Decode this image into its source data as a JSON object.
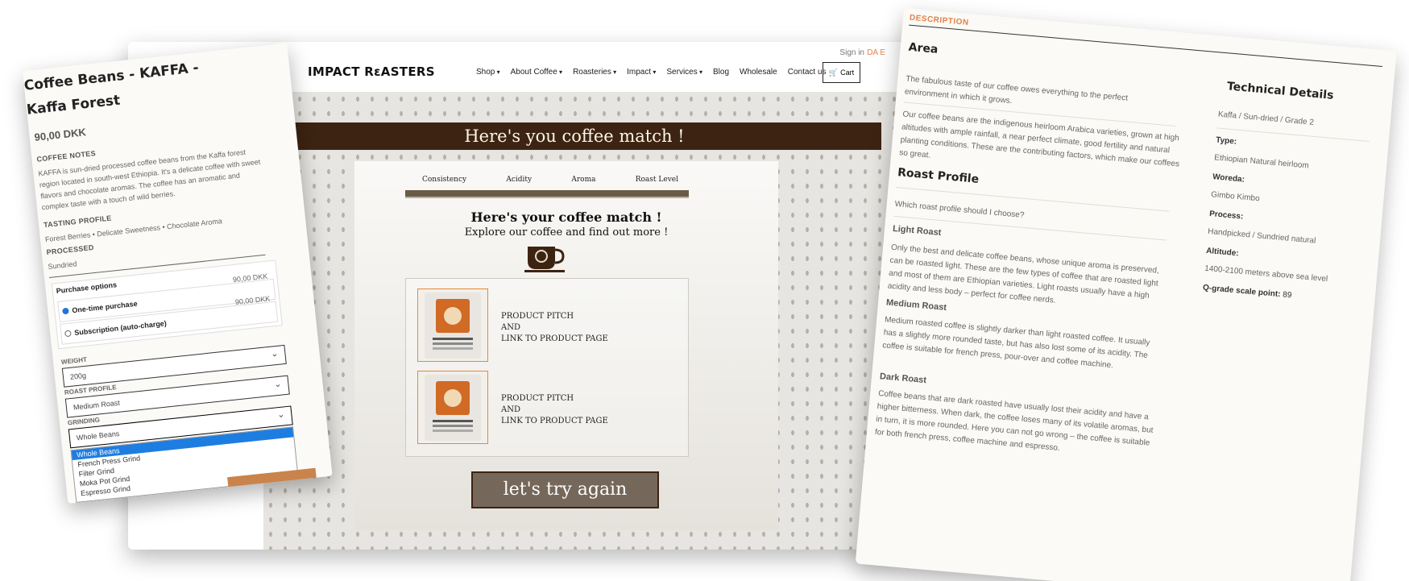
{
  "page": {
    "signin": "Sign in",
    "lang": "DA E",
    "logo": "IMPACT RɛASTERS",
    "nav": [
      "Shop",
      "About Coffee",
      "Roasteries",
      "Impact",
      "Services",
      "Blog",
      "Wholesale",
      "Contact us"
    ],
    "cart": "Cart",
    "banner": "Here's you coffee match !",
    "tabs": [
      "Consistency",
      "Acidity",
      "Aroma",
      "Roast Level"
    ],
    "match_title": "Here's your coffee match !",
    "match_subtitle": "Explore our coffee and find out more !",
    "products": [
      {
        "line1": "PRODUCT PITCH",
        "line2": "AND",
        "line3": "LINK TO PRODUCT PAGE"
      },
      {
        "line1": "PRODUCT PITCH",
        "line2": "AND",
        "line3": "LINK TO PRODUCT PAGE"
      }
    ],
    "try_again": "let's try again"
  },
  "product": {
    "title": "Coffee Beans - KAFFA - Kaffa Forest",
    "price": "90,00 DKK",
    "notes_h": "COFFEE NOTES",
    "notes": "KAFFA is sun-dried processed coffee beans from the Kaffa forest region located in south-west Ethiopia. It's a delicate coffee with sweet flavors and chocolate aromas. The coffee has an aromatic and complex taste with a touch of wild berries.",
    "tasting_h": "TASTING PROFILE",
    "tasting": "Forest Berries • Delicate Sweetness • Chocolate Aroma",
    "processed_h": "PROCESSED",
    "processed": "Sundried",
    "purchase_h": "Purchase options",
    "one_time": "One-time purchase",
    "one_time_price": "90,00 DKK",
    "subscription": "Subscription (auto-charge)",
    "subscription_price": "90,00 DKK",
    "weight_label": "WEIGHT",
    "weight": "200g",
    "roast_label": "ROAST PROFILE",
    "roast": "Medium Roast",
    "grinding_label": "GRINDING",
    "grinding": "Whole Beans",
    "grind_options": [
      "Whole Beans",
      "French Press Grind",
      "Filter Grind",
      "Moka Pot Grind",
      "Espresso Grind"
    ]
  },
  "description": {
    "heading": "DESCRIPTION",
    "area_h": "Area",
    "area_p1": "The fabulous taste of our coffee owes everything to the perfect environment in which it grows.",
    "area_p2": "Our coffee beans are the indigenous heirloom Arabica varieties, grown at high altitudes with ample rainfall, a near perfect climate, good fertility and natural planting conditions. These are the contributing factors, which make our coffees so great.",
    "roast_h": "Roast Profile",
    "roast_q": "Which roast profile should I choose?",
    "light_h": "Light Roast",
    "light_p": "Only the best and delicate coffee beans, whose unique aroma is preserved, can be roasted light. These are the few types of coffee that are roasted light and most of them are Ethiopian varieties. Light roasts usually have a high acidity and less body – perfect for coffee nerds.",
    "medium_h": "Medium Roast",
    "medium_p": "Medium roasted coffee is slightly darker than light roasted coffee. It usually has a slightly more rounded taste, but has also lost some of its acidity. The coffee is suitable for french press, pour-over and coffee machine.",
    "dark_h": "Dark Roast",
    "dark_p": "Coffee beans that are dark roasted have usually lost their acidity and have a higher bitterness. When dark, the coffee loses many of its volatile aromas, but in turn, it is more rounded. Here you can not go wrong – the coffee is suitable for both french press, coffee machine and espresso.",
    "tech_h": "Technical Details",
    "tech_sub": "Kaffa / Sun-dried / Grade 2",
    "type_k": "Type:",
    "type_v": "Ethiopian Natural heirloom",
    "woreda_k": "Woreda:",
    "woreda_v": "Gimbo Kimbo",
    "process_k": "Process:",
    "process_v": "Handpicked / Sundried natural",
    "altitude_k": "Altitude:",
    "altitude_v": "1400-2100 meters above sea level",
    "q_k": "Q-grade scale point:",
    "q_v": "89"
  },
  "colors": {
    "accent": "#e0824a",
    "banner": "#3d2412",
    "button": "#75685a",
    "dropdown_highlight": "#1e7de0"
  }
}
